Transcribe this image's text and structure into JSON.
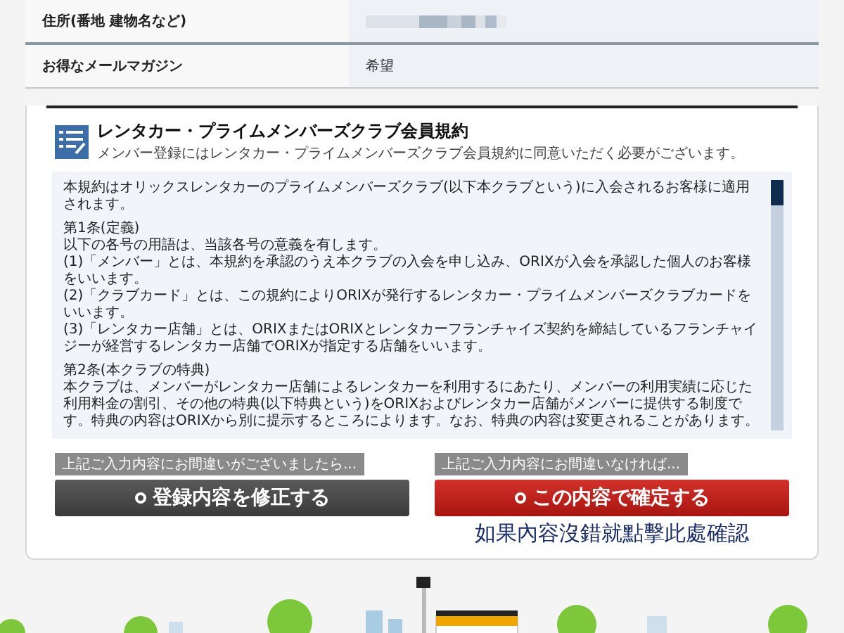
{
  "profile_rows": [
    {
      "label": "住所(番地 建物名など)",
      "kind": "masked"
    },
    {
      "label": "お得なメールマガジン",
      "kind": "text",
      "value": "希望"
    }
  ],
  "terms": {
    "title": "レンタカー・プライムメンバーズクラブ会員規約",
    "subtitle": "メンバー登録にはレンタカー・プライムメンバーズクラブ会員規約に同意いただく必要がございます。",
    "paragraphs": [
      [
        "本規約はオリックスレンタカーのプライムメンバーズクラブ(以下本クラブという)に入会されるお客様に適用されます。"
      ],
      [
        "第1条(定義)",
        "以下の各号の用語は、当該各号の意義を有します。",
        "(1)「メンバー」とは、本規約を承認のうえ本クラブの入会を申し込み、ORIXが入会を承認した個人のお客様をいいます。",
        "(2)「クラブカード」とは、この規約によりORIXが発行するレンタカー・プライムメンバーズクラブカードをいいます。",
        "(3)「レンタカー店舗」とは、ORIXまたはORIXとレンタカーフランチャイズ契約を締結しているフランチャイジーが経営するレンタカー店舗でORIXが指定する店舗をいいます。"
      ],
      [
        "第2条(本クラブの特典)",
        "本クラブは、メンバーがレンタカー店舗によるレンタカーを利用するにあたり、メンバーの利用実績に応じた利用料金の割引、その他の特典(以下特典という)をORIXおよびレンタカー店舗がメンバーに提供する制度です。特典の内容はORIXから別に提示するところによります。なお、特典の内容は変更されることがあります。"
      ]
    ]
  },
  "buttons": [
    {
      "kind": "edit",
      "hint": "上記ご入力内容にお間違いがございましたら...",
      "label": "登録内容を修正する"
    },
    {
      "kind": "confirm",
      "hint": "上記ご入力内容にお間違いなければ...",
      "label": "この内容で確定する"
    }
  ],
  "annotation": "如果內容沒錯就點擊此處確認"
}
